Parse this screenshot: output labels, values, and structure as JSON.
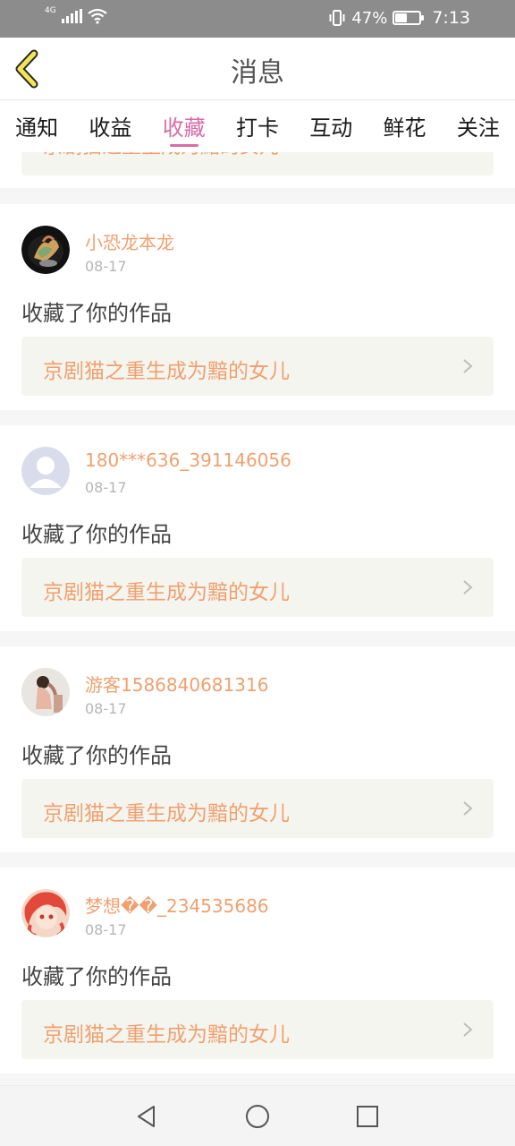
{
  "status_bar": {
    "network": "4G",
    "battery_text": "47%",
    "battery_level": 0.47,
    "time": "7:13"
  },
  "header": {
    "title": "消息"
  },
  "tabs": [
    {
      "label": "通知"
    },
    {
      "label": "收益"
    },
    {
      "label": "收藏",
      "active": true
    },
    {
      "label": "打卡"
    },
    {
      "label": "互动"
    },
    {
      "label": "鲜花"
    },
    {
      "label": "关注"
    }
  ],
  "partial_item": {
    "work_title": "京剧猫之重生成为黯的女儿"
  },
  "items": [
    {
      "user": "小恐龙本龙",
      "date": "08-17",
      "action": "收藏了你的作品",
      "work_title": "京剧猫之重生成为黯的女儿",
      "avatar_style": "dark"
    },
    {
      "user": "180***636_391146056",
      "date": "08-17",
      "action": "收藏了你的作品",
      "work_title": "京剧猫之重生成为黯的女儿",
      "avatar_style": "default"
    },
    {
      "user": "游客1586840681316",
      "date": "08-17",
      "action": "收藏了你的作品",
      "work_title": "京剧猫之重生成为黯的女儿",
      "avatar_style": "photo"
    },
    {
      "user": "梦想��_234535686",
      "date": "08-17",
      "action": "收藏了你的作品",
      "work_title": "京剧猫之重生成为黯的女儿",
      "avatar_style": "red"
    }
  ],
  "colors": {
    "accent": "#d96ba6",
    "username": "#f0a06f",
    "card_box": "#f5f5ef"
  },
  "nav": {
    "back": "back-icon",
    "home": "home-icon",
    "recents": "recents-icon"
  }
}
